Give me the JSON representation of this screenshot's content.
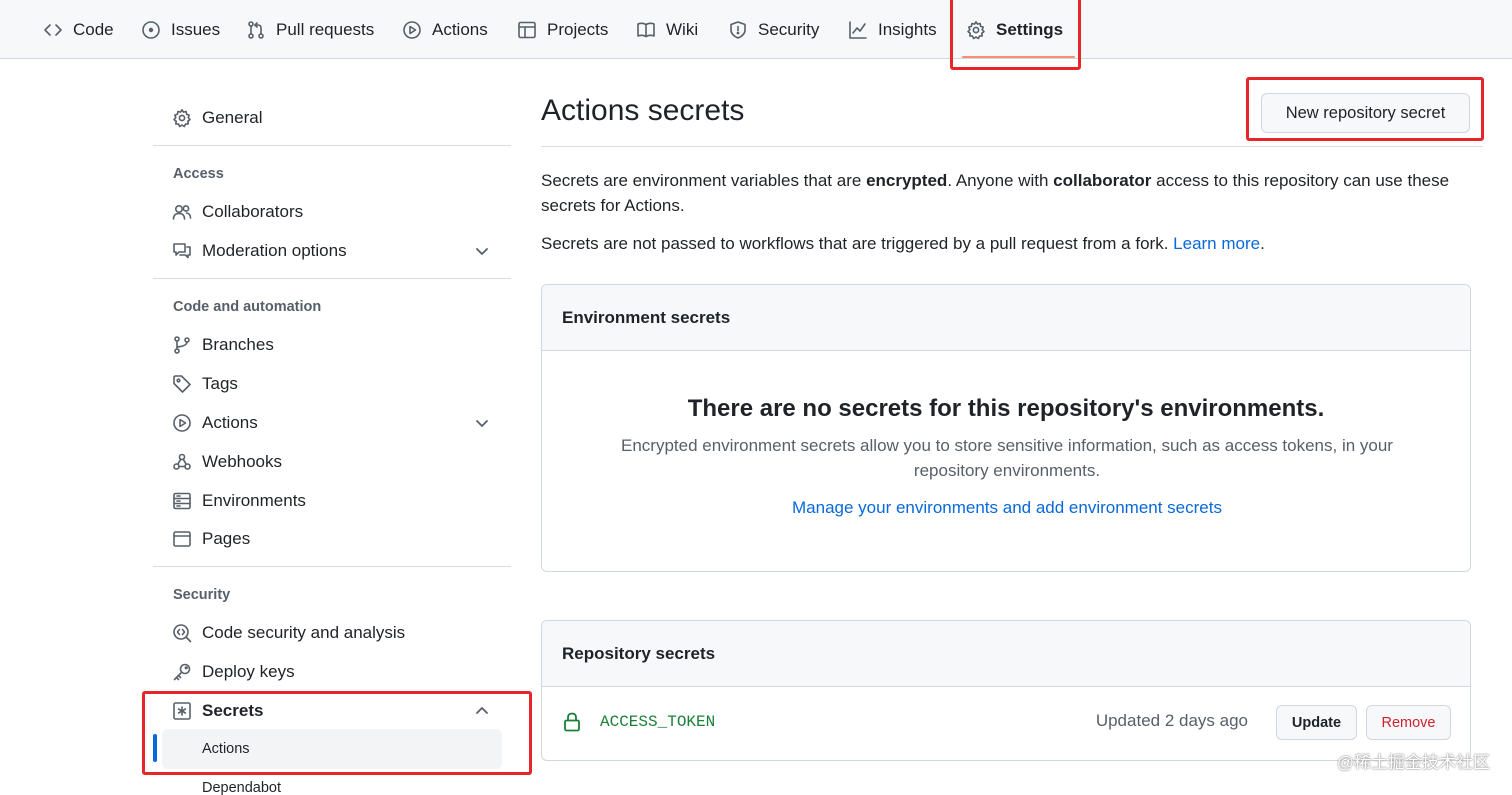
{
  "repo_nav": {
    "items": [
      {
        "label": "Code",
        "icon": "code-icon"
      },
      {
        "label": "Issues",
        "icon": "issue-opened-icon"
      },
      {
        "label": "Pull requests",
        "icon": "git-pull-request-icon"
      },
      {
        "label": "Actions",
        "icon": "play-icon"
      },
      {
        "label": "Projects",
        "icon": "table-icon"
      },
      {
        "label": "Wiki",
        "icon": "book-icon"
      },
      {
        "label": "Security",
        "icon": "shield-icon"
      },
      {
        "label": "Insights",
        "icon": "graph-icon"
      },
      {
        "label": "Settings",
        "icon": "gear-icon"
      }
    ],
    "active": "Settings",
    "active_underline_color": "#fd8c73"
  },
  "sidebar": {
    "general": "General",
    "sections": [
      {
        "heading": "Access",
        "items": [
          "Collaborators",
          "Moderation options"
        ]
      },
      {
        "heading": "Code and automation",
        "items": [
          "Branches",
          "Tags",
          "Actions",
          "Webhooks",
          "Environments",
          "Pages"
        ]
      },
      {
        "heading": "Security",
        "items": [
          "Code security and analysis",
          "Deploy keys",
          "Secrets"
        ]
      }
    ],
    "secrets_subitems": [
      "Actions",
      "Dependabot"
    ],
    "selected": "Actions",
    "selected_accent": "#0969da"
  },
  "main": {
    "title": "Actions secrets",
    "new_secret_button": "New repository secret",
    "intro": {
      "part1": "Secrets are environment variables that are ",
      "bold1": "encrypted",
      "part2": ". Anyone with ",
      "bold2": "collaborator",
      "part3": " access to this repository can use these secrets for Actions."
    },
    "fork_note": "Secrets are not passed to workflows that are triggered by a pull request from a fork.",
    "learn_more": "Learn more",
    "environment_secrets": {
      "heading": "Environment secrets",
      "blank_title": "There are no secrets for this repository's environments.",
      "blank_text": "Encrypted environment secrets allow you to store sensitive information, such as access tokens, in your repository environments.",
      "manage_link": "Manage your environments and add environment secrets"
    },
    "repository_secrets": {
      "heading": "Repository secrets",
      "items": [
        {
          "name": "ACCESS_TOKEN",
          "updated": "Updated 2 days ago",
          "update_label": "Update",
          "remove_label": "Remove"
        }
      ]
    }
  },
  "highlight_color": "#e5262a",
  "link_color": "#0969da",
  "danger_color": "#cf222e",
  "success_color": "#1a7f37",
  "watermark": "@稀土掘金技术社区"
}
